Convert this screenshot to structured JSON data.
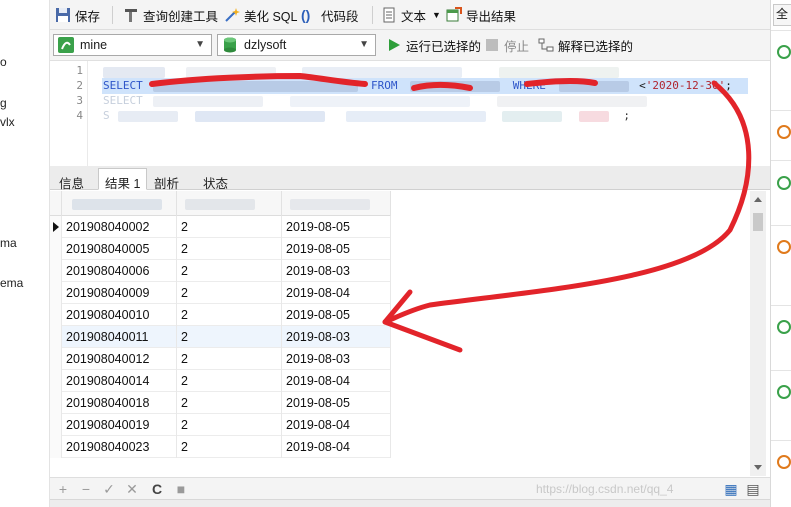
{
  "left_panel": {
    "fragments": [
      "o",
      "g",
      "vlx",
      "ma",
      "ema"
    ]
  },
  "toolbar": {
    "save_label": "保存",
    "query_builder_label": "查询创建工具",
    "beautify_label": "美化 SQL",
    "snippet_label": "代码段",
    "text_label": "文本",
    "export_label": "导出结果"
  },
  "connection": {
    "connection_value": "mine",
    "database_value": "dzlysoft",
    "run_selected_label": "运行已选择的",
    "stop_label": "停止",
    "explain_selected_label": "解释已选择的"
  },
  "editor": {
    "line_numbers": [
      "1",
      "2",
      "3",
      "4"
    ],
    "line2": {
      "select_kw": "SELECT",
      "from_kw": "FROM",
      "where_kw": "WHERE",
      "operator": "<",
      "date_literal": "'2020-12-30'",
      "terminator": ";"
    },
    "line3_start": "SELECT",
    "line4_start": "S",
    "line4_end": ";"
  },
  "tabs": {
    "info": "信息",
    "result1": "结果 1",
    "profile": "剖析",
    "status": "状态"
  },
  "grid": {
    "rows": [
      {
        "id": "201908040002",
        "count": "2",
        "date": "2019-08-05"
      },
      {
        "id": "201908040005",
        "count": "2",
        "date": "2019-08-05"
      },
      {
        "id": "201908040006",
        "count": "2",
        "date": "2019-08-03"
      },
      {
        "id": "201908040009",
        "count": "2",
        "date": "2019-08-04"
      },
      {
        "id": "201908040010",
        "count": "2",
        "date": "2019-08-05"
      },
      {
        "id": "201908040011",
        "count": "2",
        "date": "2019-08-03"
      },
      {
        "id": "201908040012",
        "count": "2",
        "date": "2019-08-03"
      },
      {
        "id": "201908040014",
        "count": "2",
        "date": "2019-08-04"
      },
      {
        "id": "201908040018",
        "count": "2",
        "date": "2019-08-05"
      },
      {
        "id": "201908040019",
        "count": "2",
        "date": "2019-08-04"
      },
      {
        "id": "201908040023",
        "count": "2",
        "date": "2019-08-04"
      }
    ]
  },
  "bottom_bar": {
    "add_icon": "+",
    "remove_icon": "−",
    "apply_icon": "✓",
    "cancel_icon": "✕",
    "refresh_icon": "C",
    "stop_icon": "■",
    "watermark": "https://blog.csdn.net/qq_4"
  },
  "right_panel": {
    "tab_label": "全"
  },
  "colors": {
    "keyword": "#2e56c9",
    "string": "#b0252f",
    "annotation_red": "#e2242a",
    "selection": "#cfe3fb",
    "run_green": "#2e9e3a"
  }
}
